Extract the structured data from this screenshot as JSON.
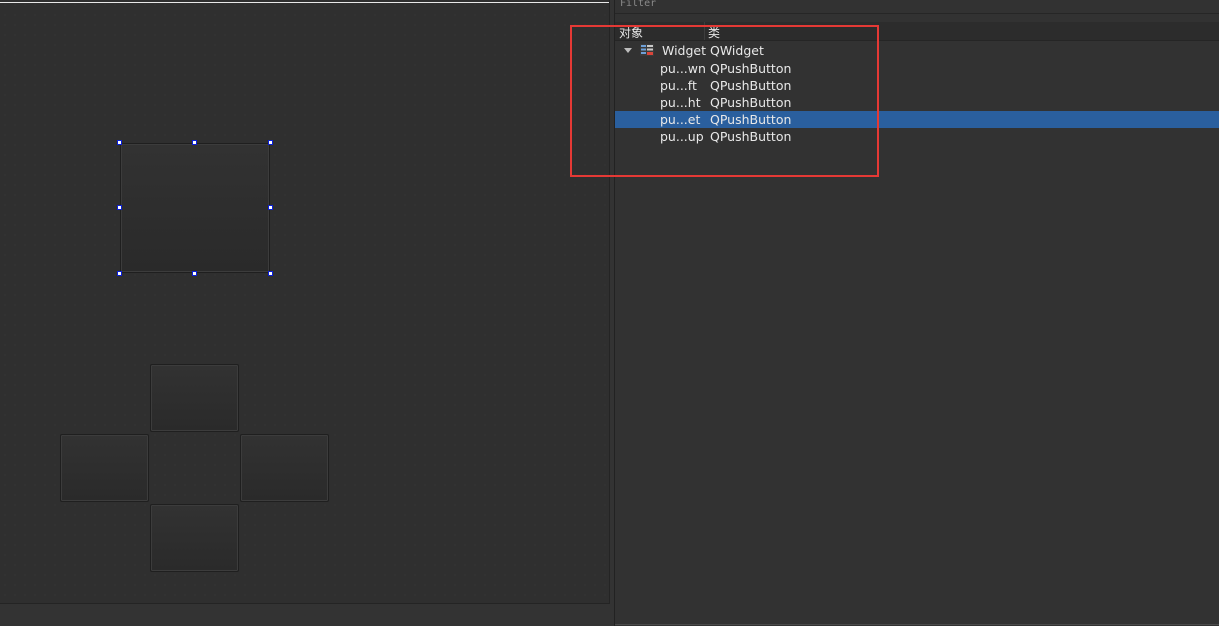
{
  "filter_label": "Filter",
  "inspector": {
    "columns": {
      "object": "对象",
      "class": "类"
    },
    "root": {
      "object": "Widget",
      "class": "QWidget",
      "expanded": true
    },
    "children": [
      {
        "object": "pu...wn",
        "class": "QPushButton",
        "selected": false
      },
      {
        "object": "pu...ft",
        "class": "QPushButton",
        "selected": false
      },
      {
        "object": "pu...ht",
        "class": "QPushButton",
        "selected": false
      },
      {
        "object": "pu...et",
        "class": "QPushButton",
        "selected": true
      },
      {
        "object": "pu...up",
        "class": "QPushButton",
        "selected": false
      }
    ]
  },
  "colors": {
    "background": "#333333",
    "selection": "#2a5f9e",
    "annotation": "#e53935",
    "handle_border": "#0b1fd6"
  }
}
